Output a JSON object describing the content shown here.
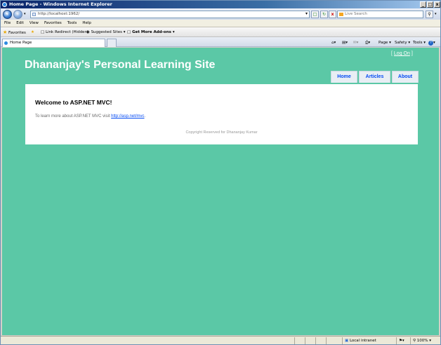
{
  "window": {
    "title": "Home Page - Windows Internet Explorer",
    "controls": [
      "_",
      "□",
      "x"
    ]
  },
  "address": {
    "url": "http://localhost:1962/",
    "search_placeholder": "Live Search"
  },
  "menu": [
    "File",
    "Edit",
    "View",
    "Favorites",
    "Tools",
    "Help"
  ],
  "favorites": {
    "favorites_label": "Favorites",
    "items": [
      "Link Redirect (Hidden)",
      "Suggested Sites ▾",
      "Get More Add-ons ▾"
    ]
  },
  "tab": {
    "label": "Home Page"
  },
  "commandbar": {
    "page": "Page ▾",
    "safety": "Safety ▾",
    "tools": "Tools ▾",
    "help": "▾"
  },
  "site": {
    "title": "Dhananjay's Personal Learning Site",
    "logon_open": "[",
    "logon_link": "Log On",
    "logon_close": "]",
    "nav": [
      "Home",
      "Articles",
      "About"
    ],
    "welcome_heading": "Welcome to ASP.NET MVC!",
    "learn_text": "To learn more about ASP.NET MVC visit",
    "learn_link": "http://asp.net/mvc",
    "learn_end": ".",
    "footer": "Copyright Reserved for Dhananjay Kumar"
  },
  "status": {
    "zone": "Local intranet",
    "zoom": "100%"
  },
  "colors": {
    "page_background": "#5bc8a6",
    "link_blue": "#034af3"
  }
}
